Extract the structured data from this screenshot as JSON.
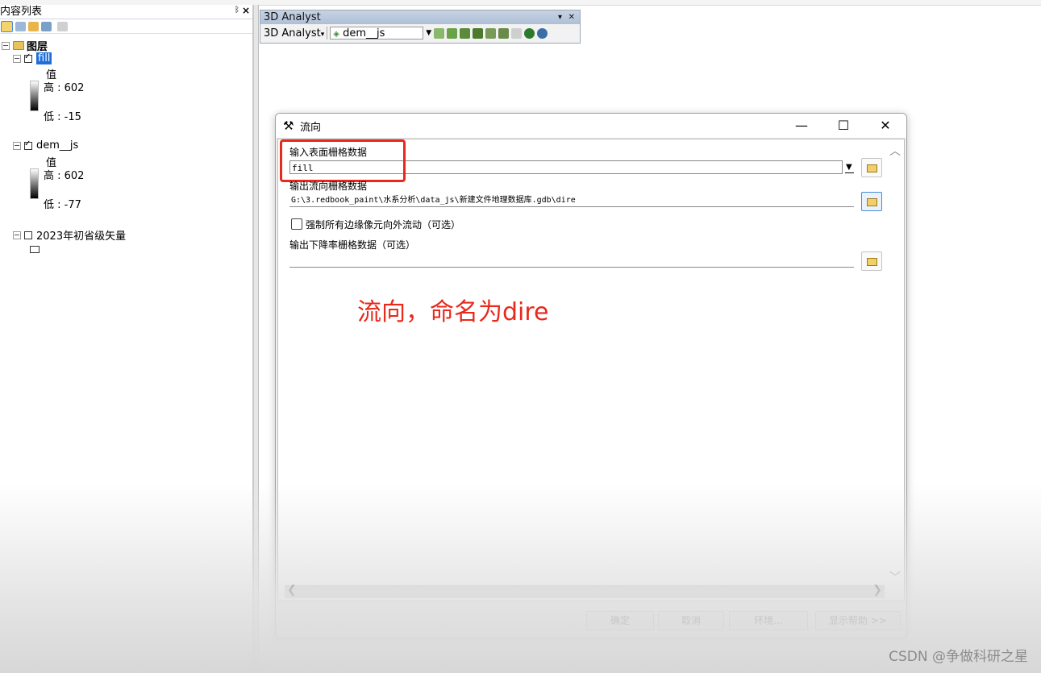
{
  "toc": {
    "title": "内容列表",
    "pin": "ᛒ",
    "close": "×",
    "root": "图层",
    "layers": [
      {
        "name": "fill",
        "checked": true,
        "legend_title": "值",
        "high": "高 : 602",
        "low": "低 : -15"
      },
      {
        "name": "dem__js",
        "checked": true,
        "legend_title": "值",
        "high": "高 : 602",
        "low": "低 : -77"
      },
      {
        "name": "2023年初省级矢量",
        "checked": false
      }
    ]
  },
  "toolbar": {
    "title": "3D Analyst",
    "menu": "3D Analyst",
    "layer_combo": "dem__js"
  },
  "dialog": {
    "title": "流向",
    "input_label": "输入表面栅格数据",
    "input_value": "fill",
    "output_label": "输出流向栅格数据",
    "output_value": "G:\\3.redbook_paint\\水系分析\\data_js\\新建文件地理数据库.gdb\\dire",
    "force_edge_label": "强制所有边缘像元向外流动（可选）",
    "force_edge_checked": false,
    "drop_label": "输出下降率栅格数据（可选）",
    "drop_value": "",
    "annotation": "流向，命名为dire",
    "buttons": {
      "ok": "确定",
      "cancel": "取消",
      "env": "环境...",
      "help": "显示帮助 >>"
    }
  },
  "watermark": "CSDN @争做科研之星",
  "colors": {
    "annotation": "#e8291c",
    "selection": "#1e6fd9"
  }
}
